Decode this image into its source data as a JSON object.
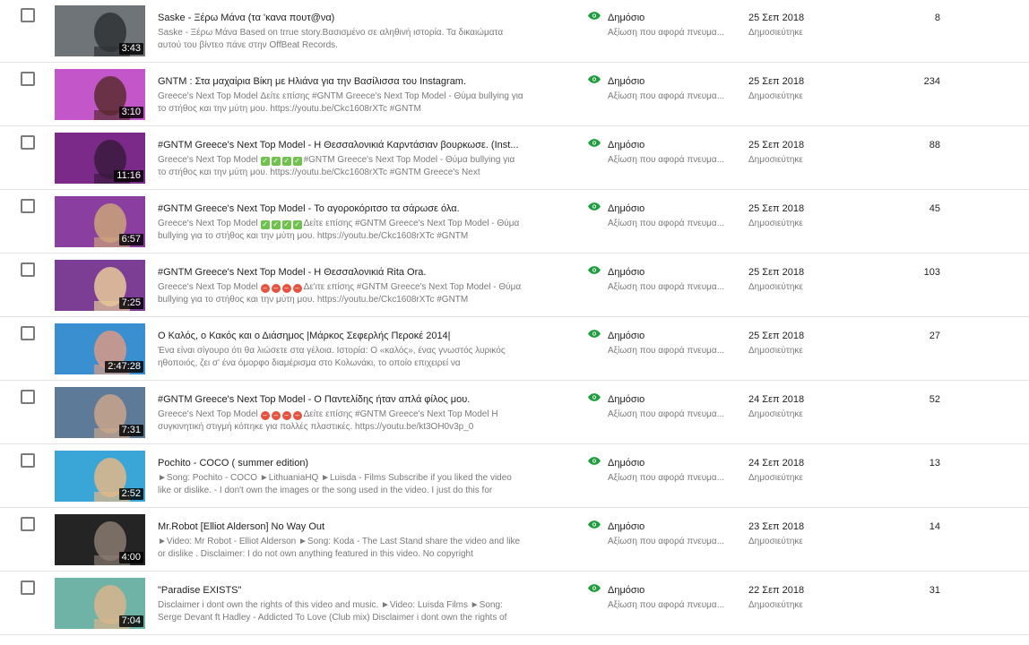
{
  "labels": {
    "restriction": "Αξίωση που αφορά πνευμα...",
    "published": "Δημοσιεύτηκε"
  },
  "colors": {
    "visibility_icon": "#1f9e3d",
    "row_divider": "#e3e3e3"
  },
  "videos": [
    {
      "title": "Saske - Ξέρω Μάνα (τα 'κανα πουτ@να)",
      "desc": "Saske - Ξέρω Μάνα Based on trrue story.Βασισμένο σε αληθινή ιστορία. Τα δικαιώματα αυτού του βίντεο πάνε στην OffBeat Records.",
      "duration": "3:43",
      "visibility": "Δημόσιο",
      "date": "25 Σεπ 2018",
      "views": "8",
      "thumb": {
        "bg": "#6f7478",
        "fg": "#2f3235"
      }
    },
    {
      "title": "GNTM : Στα μαχαίρια Βίκη με Ηλιάνα για την Βασίλισσα του Instagram.",
      "desc": "Greece's Next Top Model Δείτε επίσης #GNTM Greece's Next Top Model - Θύμα bullying για το στήθος και την μύτη μου. https://youtu.be/Ckc1608rXTc #GNTM",
      "duration": "3:10",
      "visibility": "Δημόσιο",
      "date": "25 Σεπ 2018",
      "views": "234",
      "thumb": {
        "bg": "#c356c9",
        "fg": "#5a2a30"
      }
    },
    {
      "title": "#GNTM Greece's Next Top Model - Η Θεσσαλονικιά Καρντάσιαν βουρκωσε. (Inst...",
      "desc_pre": "Greece's Next Top Model",
      "emoji": "check",
      "desc_post": "#GNTM Greece's Next Top Model - Θύμα bullying για το στήθος και την μύτη μου. https://youtu.be/Ckc1608rXTc #GNTM Greece's Next",
      "duration": "11:16",
      "visibility": "Δημόσιο",
      "date": "25 Σεπ 2018",
      "views": "88",
      "thumb": {
        "bg": "#7b2a8a",
        "fg": "#3a1a3e"
      }
    },
    {
      "title": "#GNTM Greece's Next Top Model - Το αγοροκόριτσο τα σάρωσε όλα.",
      "desc_pre": "Greece's Next Top Model",
      "emoji": "check",
      "desc_post": "Δείτε επίσης #GNTM Greece's Next Top Model - Θύμα bullying για το στήθος και την μύτη μου. https://youtu.be/Ckc1608rXTc #GNTM",
      "duration": "6:57",
      "visibility": "Δημόσιο",
      "date": "25 Σεπ 2018",
      "views": "45",
      "thumb": {
        "bg": "#8a3fa0",
        "fg": "#caa37a"
      }
    },
    {
      "title": "#GNTM Greece's Next Top Model - Η Θεσσαλονικιά Rita Ora.",
      "desc_pre": "Greece's Next Top Model",
      "emoji": "stop",
      "desc_post": "Δε'ιτε επίσης #GNTM Greece's Next Top Model - Θύμα bullying για το στήθος και την μύτη μου. https://youtu.be/Ckc1608rXTc #GNTM",
      "duration": "7:25",
      "visibility": "Δημόσιο",
      "date": "25 Σεπ 2018",
      "views": "103",
      "thumb": {
        "bg": "#7c3d95",
        "fg": "#e6c89a"
      }
    },
    {
      "title": "Ο Καλός, ο Κακός και ο Διάσημος |Μάρκος Σεφερλής Περοκέ 2014|",
      "desc": "Ένα είναι σίγουρο ότι θα λιώσετε στα γέλοια. Ιστορία: Ο «καλός», ένας γνωστός λυρικός ηθοποιός, ζει σ' ένα όμορφο διαμέρισμα στο Κολωνάκι, το οποίο επιχειρεί να",
      "duration": "2:47:28",
      "visibility": "Δημόσιο",
      "date": "25 Σεπ 2018",
      "views": "27",
      "thumb": {
        "bg": "#3a8fd0",
        "fg": "#d99a86"
      }
    },
    {
      "title": "#GNTM Greece's Next Top Model - Ο Παντελίδης ήταν απλά φίλος μου.",
      "desc_pre": "Greece's Next Top Model",
      "emoji": "stop",
      "desc_post": "Δείτε επίσης #GNTM Greece's Next Top Model Η συγκινητική στιγμή κόπηκε για πολλές πλαστικές. https://youtu.be/kt3OH0v3p_0",
      "duration": "7:31",
      "visibility": "Δημόσιο",
      "date": "24 Σεπ 2018",
      "views": "52",
      "thumb": {
        "bg": "#5d7a98",
        "fg": "#c9a58c"
      }
    },
    {
      "title": "Pochito - COCO ( summer edition)",
      "desc": "►Song: Pochito - COCO ►LithuaniaHQ ►Luisda - Films Subscribe if you liked the video like or dislike. - I don't own the images or the song used in the video. I just do this for",
      "duration": "2:52",
      "visibility": "Δημόσιο",
      "date": "24 Σεπ 2018",
      "views": "13",
      "thumb": {
        "bg": "#3aa6d8",
        "fg": "#e3b787"
      }
    },
    {
      "title": "Mr.Robot [Elliot Alderson] No Way Out",
      "desc": "►Video: Mr Robot - Elliot Alderson ►Song: Koda - The Last Stand share the video and like or dislike . Disclaimer: I do not own anything featured in this video. No copyright",
      "duration": "4:00",
      "visibility": "Δημόσιο",
      "date": "23 Σεπ 2018",
      "views": "14",
      "thumb": {
        "bg": "#242424",
        "fg": "#8a7a70"
      }
    },
    {
      "title": "\"Paradise EXISTS\"",
      "desc": "Disclaimer i dont own the rights of this video and music. ►Video: Luisda Films ►Song: Serge Devant ft Hadley - Addicted To Love (Club mix) Disclaimer i dont own the rights of",
      "duration": "7:04",
      "visibility": "Δημόσιο",
      "date": "22 Σεπ 2018",
      "views": "31",
      "thumb": {
        "bg": "#6fb2a6",
        "fg": "#d8b48c"
      }
    }
  ]
}
